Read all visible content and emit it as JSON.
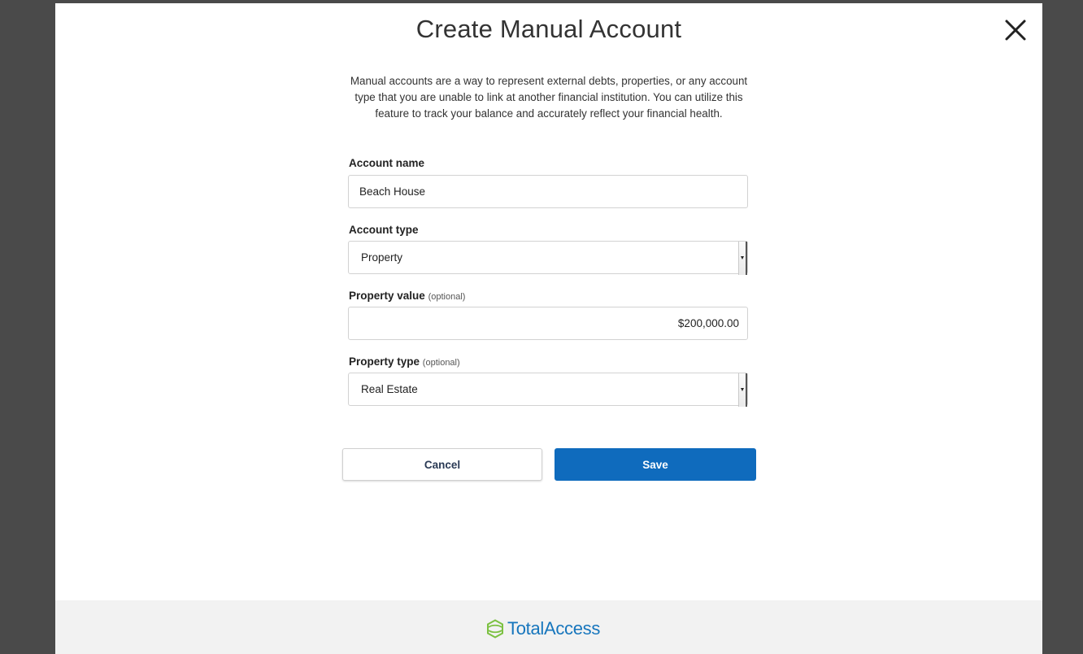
{
  "modal": {
    "title": "Create Manual Account",
    "description": "Manual accounts are a way to represent external debts, properties, or any account type that you are unable to link at another financial institution. You can utilize this feature to track your balance and accurately reflect your financial health."
  },
  "form": {
    "account_name": {
      "label": "Account name",
      "value": "Beach House"
    },
    "account_type": {
      "label": "Account type",
      "value": "Property"
    },
    "property_value": {
      "label": "Property value",
      "optional": "(optional)",
      "value": "$200,000.00"
    },
    "property_type": {
      "label": "Property type",
      "optional": "(optional)",
      "value": "Real Estate"
    }
  },
  "actions": {
    "cancel_label": "Cancel",
    "save_label": "Save"
  },
  "footer": {
    "brand": "TotalAccess"
  },
  "icons": {
    "close": "close-icon",
    "logo": "totalaccess-logo-icon"
  },
  "colors": {
    "primary": "#0f6bbd",
    "brand_green": "#7cc142",
    "brand_blue": "#1776bd",
    "backdrop": "#4a4a4a"
  }
}
